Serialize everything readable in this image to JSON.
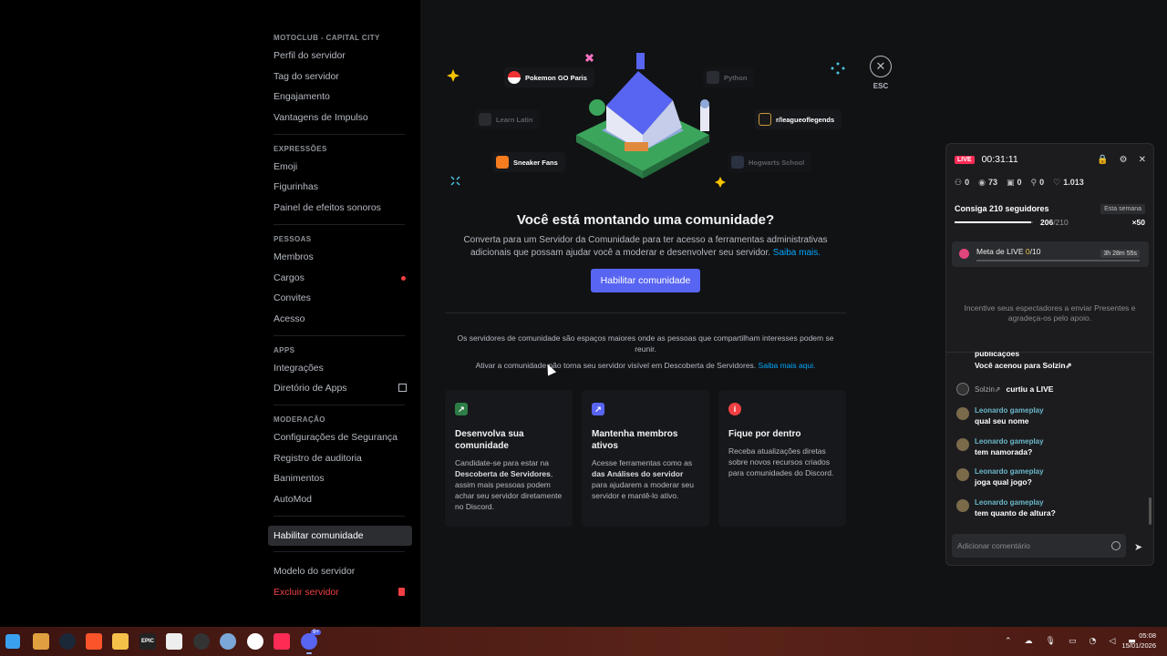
{
  "window": {
    "minimize": "—",
    "maximize": "☐",
    "close": "✕"
  },
  "sidebar": {
    "server_name": "MOTOCLUB - CAPITAL CITY",
    "server_items": [
      "Perfil do servidor",
      "Tag do servidor",
      "Engajamento",
      "Vantagens de Impulso"
    ],
    "expressions_label": "EXPRESSÕES",
    "expressions_items": [
      "Emoji",
      "Figurinhas",
      "Painel de efeitos sonoros"
    ],
    "people_label": "PESSOAS",
    "people_items": [
      "Membros",
      "Cargos",
      "Convites",
      "Acesso"
    ],
    "apps_label": "APPS",
    "apps_items": [
      "Integrações",
      "Diretório de Apps"
    ],
    "moderation_label": "MODERAÇÃO",
    "moderation_items": [
      "Configurações de Segurança",
      "Registro de auditoria",
      "Banimentos",
      "AutoMod"
    ],
    "community_item": "Habilitar comunidade",
    "template_item": "Modelo do servidor",
    "delete_item": "Excluir servidor"
  },
  "close": {
    "icon": "✕",
    "label": "ESC"
  },
  "hero": {
    "tags": {
      "pokemon": "Pokemon GO Paris",
      "python": "Python",
      "latin": "Learn Latin",
      "lol": "r/leagueoflegends",
      "sneaker": "Sneaker Fans",
      "hogwarts": "Hogwarts School"
    },
    "title": "Você está montando uma comunidade?",
    "description": "Converta para um Servidor da Comunidade para ter acesso a ferramentas administrativas adicionais que possam ajudar você a moderar e desenvolver seu servidor.",
    "learn_more": "Saiba mais.",
    "button": "Habilitar comunidade",
    "info1": "Os servidores de comunidade são espaços maiores onde as pessoas que compartilham interesses podem se reunir.",
    "info2": "Ativar a comunidade não torna seu servidor visível em Descoberta de Servidores.",
    "info2_link": "Saiba mais aqui."
  },
  "cards": [
    {
      "icon": "growth-icon",
      "title": "Desenvolva sua comunidade",
      "text_a": "Candidate-se para estar na ",
      "text_bold": "Descoberta de Servidores",
      "text_b": ", assim mais pessoas podem achar seu servidor diretamente no Discord."
    },
    {
      "icon": "analytics-icon",
      "title": "Mantenha membros ativos",
      "text_a": "Acesse ferramentas como as ",
      "text_bold": "das Análises do servidor",
      "text_b": " para ajudarem a moderar seu servidor e mantê-lo ativo."
    },
    {
      "icon": "info-icon",
      "title": "Fique por dentro",
      "text_a": "Receba atualizações diretas sobre novos recursos criados para comunidades do Discord.",
      "text_bold": "",
      "text_b": ""
    }
  ],
  "live": {
    "badge": "LIVE",
    "time": "00:31:11",
    "icons": {
      "lock": "🔒",
      "settings": "⚙",
      "close": "✕"
    },
    "stats": {
      "users": "0",
      "viewers": "73",
      "gifts": "0",
      "shares": "0",
      "likes": "1.013"
    },
    "goal_label": "Consiga 210 seguidores",
    "week_label": "Esta semana",
    "goal_current": "206",
    "goal_total": "/210",
    "goal_fraction": 0.98,
    "multiplier": "×50",
    "meta_label": "Meta de LIVE ",
    "meta_value": "0",
    "meta_total": "/10",
    "meta_time": "3h 28m 55s",
    "empty_text": "Incentive seus espectadores a enviar Presentes e agradeça-os pelo apoio.",
    "chat": [
      {
        "type": "system",
        "line1": "publicações",
        "line2": "Você acenou para Solzin⇗"
      },
      {
        "type": "like",
        "name": "Solzin⇗",
        "text": "curtiu a LIVE"
      },
      {
        "type": "msg",
        "name": "Leonardo gameplay",
        "text": "qual seu nome"
      },
      {
        "type": "msg",
        "name": "Leonardo gameplay",
        "text": "tem namorada?"
      },
      {
        "type": "msg",
        "name": "Leonardo gameplay",
        "text": "joga qual jogo?"
      },
      {
        "type": "msg",
        "name": "Leonardo gameplay",
        "text": "tem quanto de altura?"
      }
    ],
    "input_placeholder": "Adicionar comentário"
  },
  "taskbar": {
    "apps": [
      "windows-start",
      "app",
      "steam",
      "brave",
      "file-explorer",
      "epic-games",
      "store",
      "obs",
      "settings",
      "clock-app",
      "tiktok",
      "discord"
    ],
    "badge": "9+",
    "time": "05:08",
    "date": "15/01/2026"
  }
}
